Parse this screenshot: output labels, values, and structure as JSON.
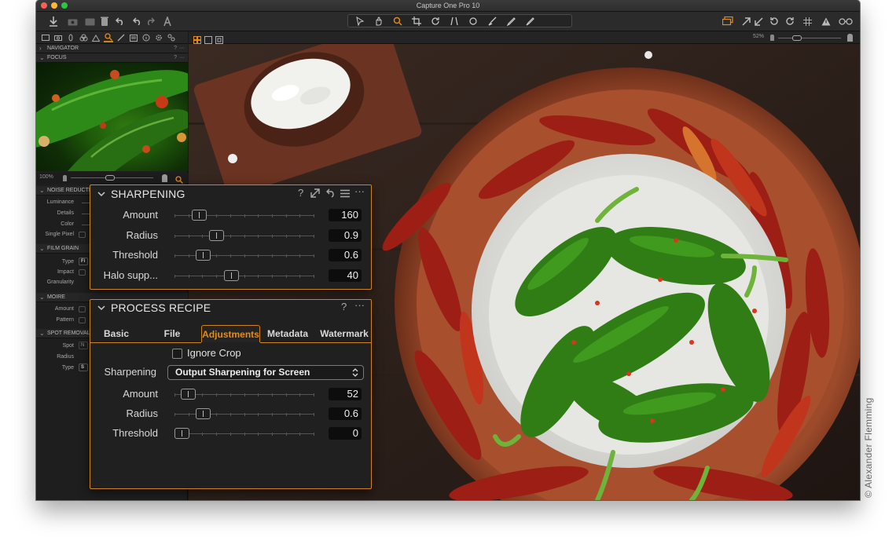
{
  "window": {
    "title": "Capture One Pro 10",
    "traffic_lights": {
      "close": "#fc5f57",
      "minimize": "#fdbc2e",
      "zoom": "#29c840"
    }
  },
  "left_panel": {
    "sections": {
      "navigator": "NAVIGATOR",
      "focus": "FOCUS",
      "noise_reduction": "NOISE REDUCTI",
      "film_grain": "FILM GRAIN",
      "moire": "MOIRE",
      "spot_removal": "SPOT REMOVAL"
    },
    "section_help": "?",
    "section_more": "···",
    "focus_zoom": "100%",
    "noise_labels": [
      "Luminance",
      "Details",
      "Color",
      "Single Pixel"
    ],
    "film_labels": [
      "Type",
      "Impact",
      "Granularity"
    ],
    "film_type_value": "Fi",
    "moire_labels": [
      "Amount",
      "Pattern"
    ],
    "spot_labels": [
      "Spot",
      "Radius",
      "Type"
    ],
    "spot_spot_value": "N",
    "spot_type_value": "S"
  },
  "viewer": {
    "zoom": "52%"
  },
  "sharpening_panel": {
    "title": "SHARPENING",
    "help": "?",
    "more": "···",
    "rows": [
      {
        "label": "Amount",
        "value": "160",
        "position": 0.14
      },
      {
        "label": "Radius",
        "value": "0.9",
        "position": 0.28
      },
      {
        "label": "Threshold",
        "value": "0.6",
        "position": 0.17
      },
      {
        "label": "Halo supp...",
        "value": "40",
        "position": 0.4
      }
    ]
  },
  "recipe_panel": {
    "title": "PROCESS RECIPE",
    "help": "?",
    "more": "···",
    "tabs": [
      "Basic",
      "File",
      "Adjustments",
      "Metadata",
      "Watermark"
    ],
    "active_tab": "Adjustments",
    "ignore_crop_label": "Ignore Crop",
    "ignore_crop_checked": false,
    "sharpening_label": "Sharpening",
    "sharpening_value": "Output Sharpening for Screen",
    "rows": [
      {
        "label": "Amount",
        "value": "52",
        "position": 0.05
      },
      {
        "label": "Radius",
        "value": "0.6",
        "position": 0.17
      },
      {
        "label": "Threshold",
        "value": "0",
        "position": 0.0
      }
    ]
  },
  "credit": "© Alexander Flemming",
  "colors": {
    "accent": "#d0821c",
    "accent_text": "#e38a1c"
  }
}
